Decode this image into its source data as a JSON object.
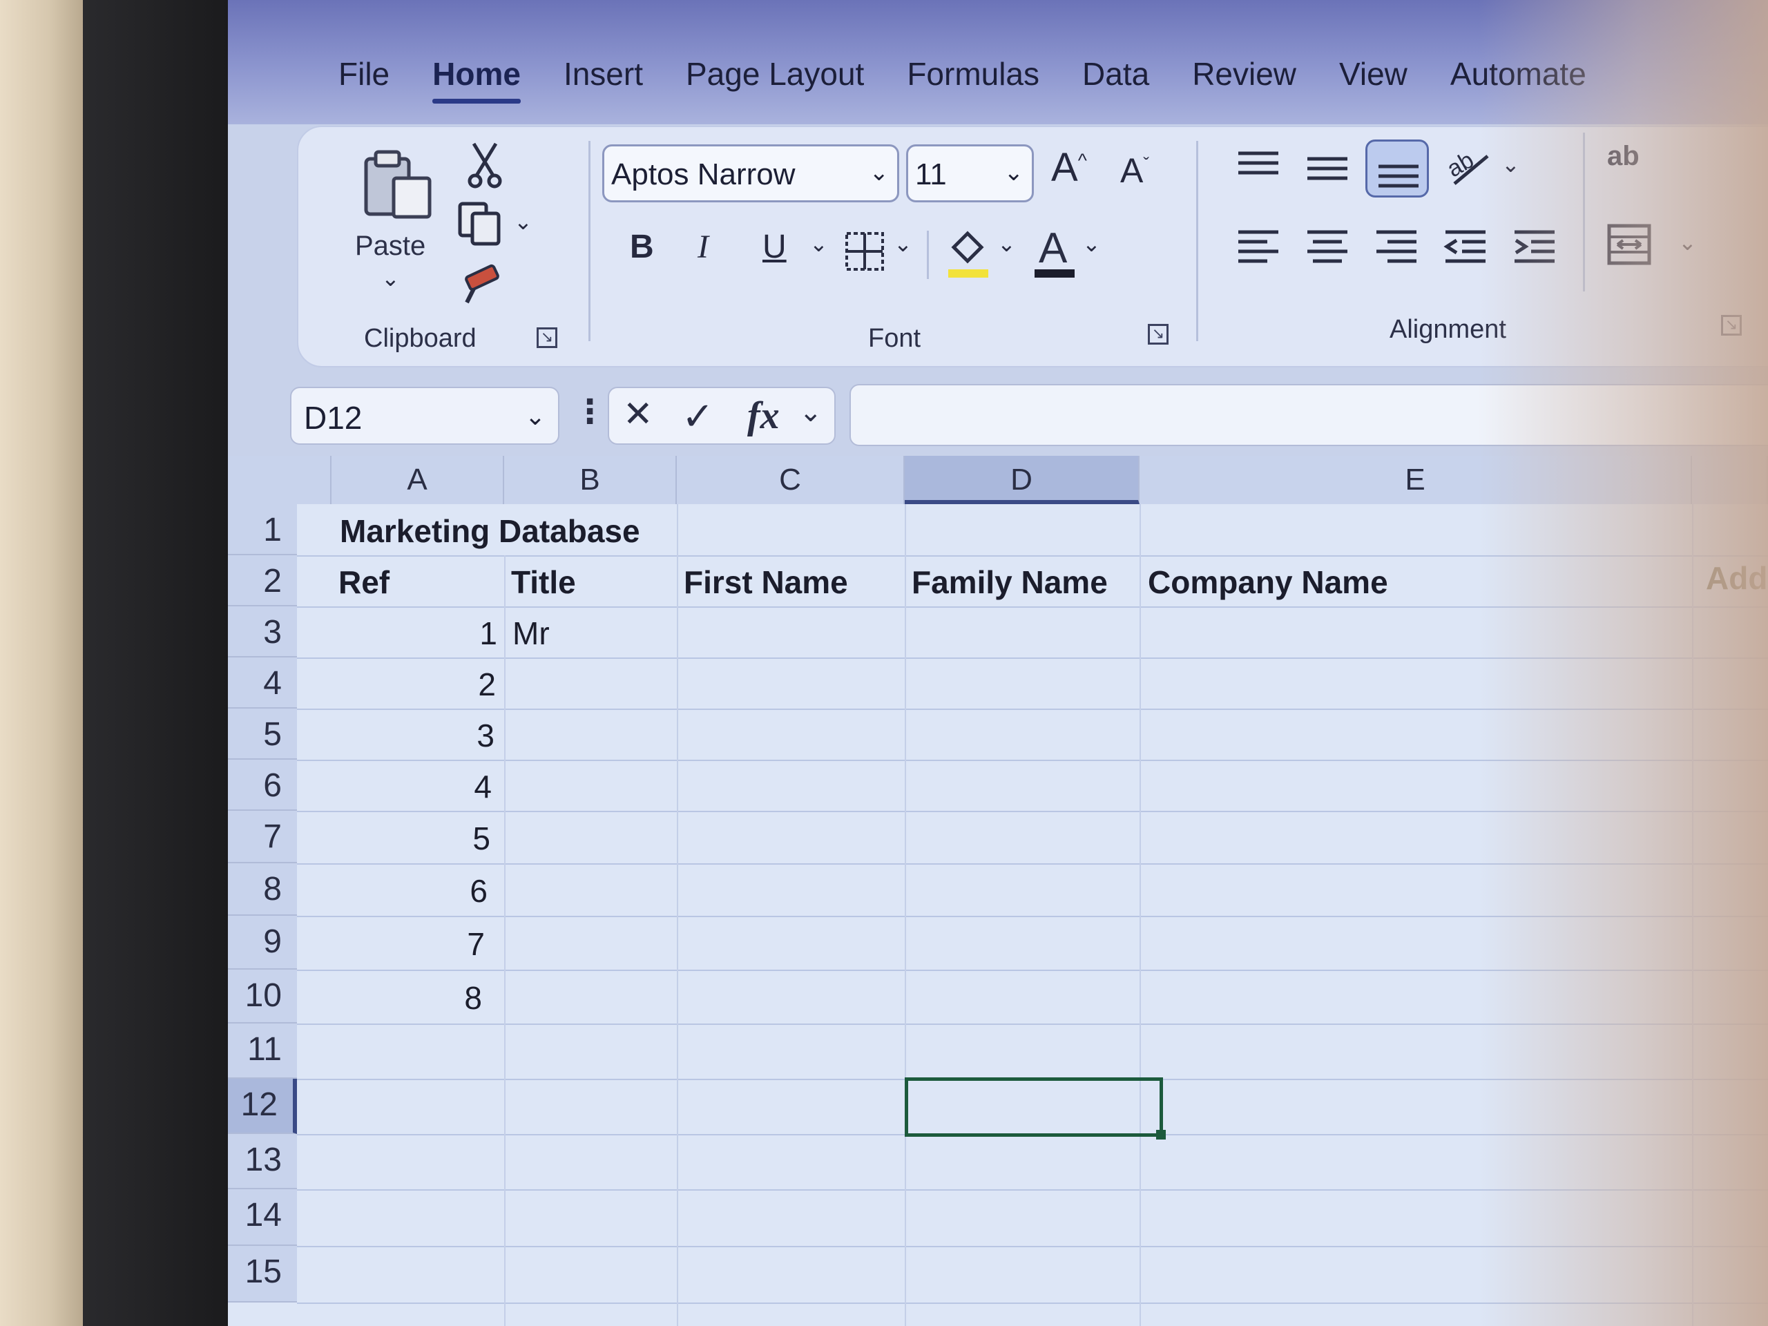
{
  "tabs": [
    "File",
    "Home",
    "Insert",
    "Page Layout",
    "Formulas",
    "Data",
    "Review",
    "View",
    "Automate"
  ],
  "active_tab": "Home",
  "ribbon": {
    "clipboard": {
      "paste_label": "Paste",
      "group_label": "Clipboard"
    },
    "font": {
      "font_name": "Aptos Narrow",
      "font_size": "11",
      "bold": "B",
      "italic": "I",
      "underline": "U",
      "group_label": "Font"
    },
    "alignment": {
      "group_label": "Alignment",
      "wrap_icon_text": "ab"
    }
  },
  "formula_bar": {
    "name_box": "D12",
    "cancel": "✕",
    "enter": "✓",
    "fx": "fx",
    "value": ""
  },
  "columns": [
    "A",
    "B",
    "C",
    "D",
    "E"
  ],
  "selected_column": "D",
  "rows": [
    "1",
    "2",
    "3",
    "4",
    "5",
    "6",
    "7",
    "8",
    "9",
    "10",
    "11",
    "12",
    "13",
    "14",
    "15"
  ],
  "selected_row": "12",
  "cells": {
    "A1": "Marketing Database",
    "A2": "Ref",
    "B2": "Title",
    "C2": "First Name",
    "D2": "Family Name",
    "E2": "Company Name",
    "F2": "Add",
    "A3": "1",
    "B3": "Mr",
    "A4": "2",
    "A5": "3",
    "A6": "4",
    "A7": "5",
    "A8": "6",
    "A9": "7",
    "A10": "8"
  },
  "colors": {
    "selection_border": "#1c5a3c",
    "header_selected": "#aab8dc",
    "active_tab_underline": "#2b3a88"
  }
}
